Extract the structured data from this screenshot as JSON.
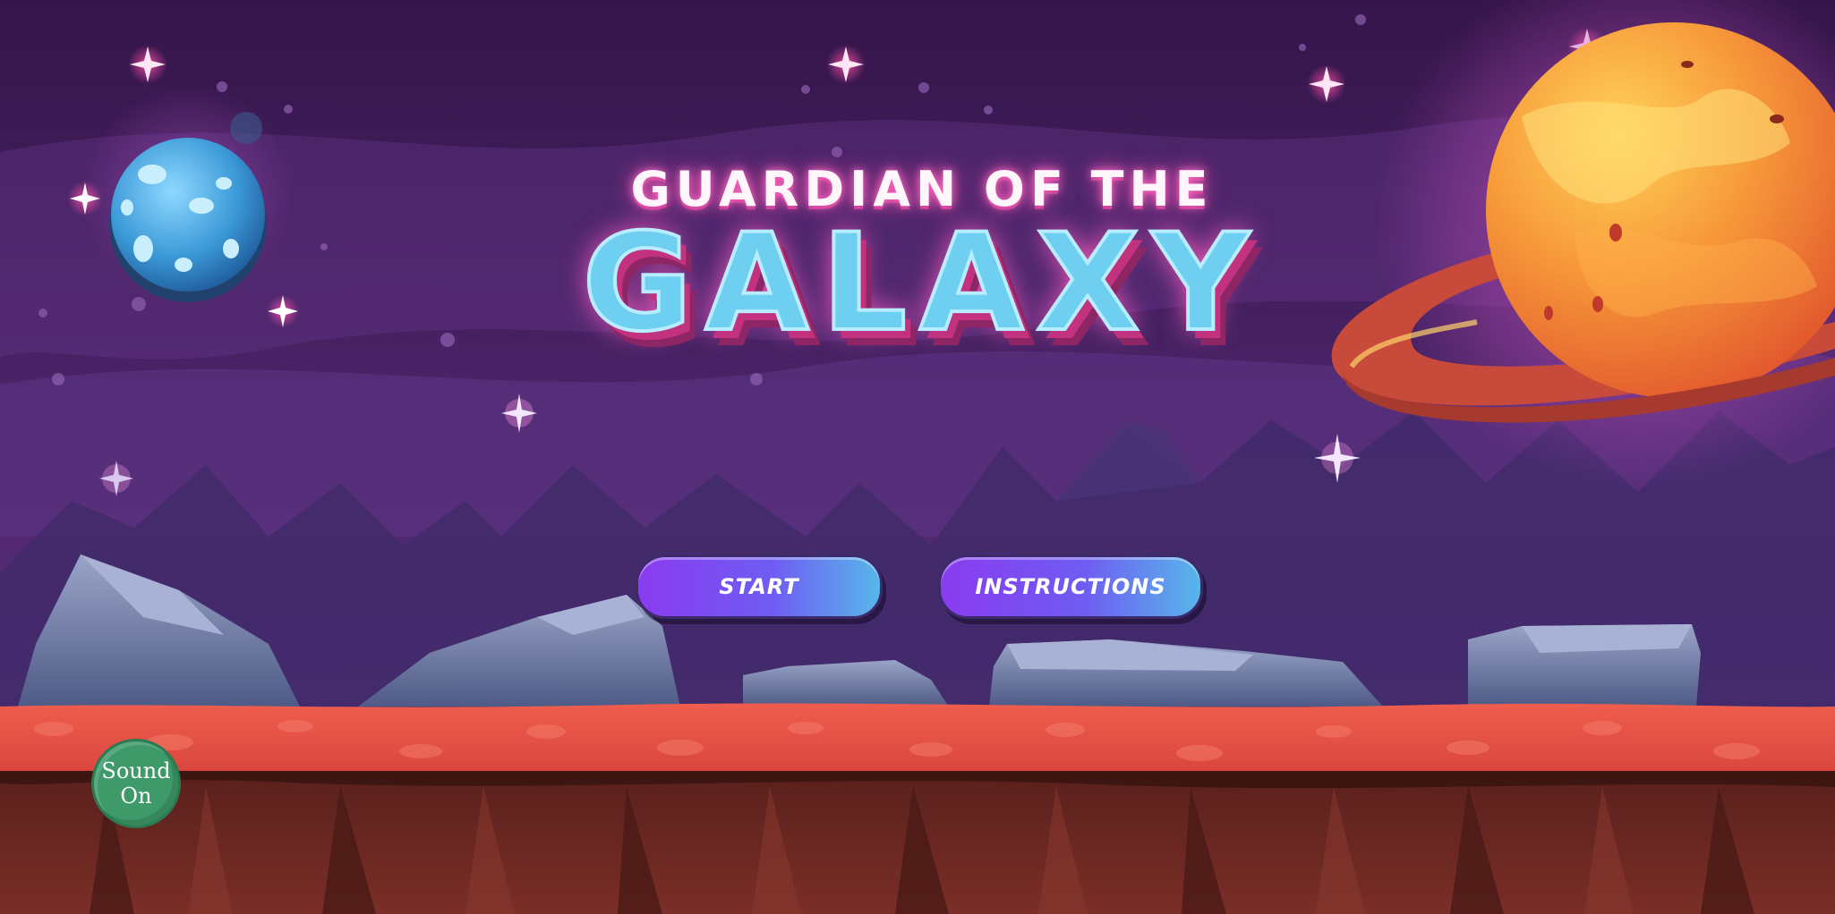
{
  "game": {
    "title_line1": "GUARDIAN OF THE",
    "title_line2": "GALAXY"
  },
  "menu": {
    "start_label": "START",
    "instructions_label": "INSTRUCTIONS"
  },
  "sound_toggle": {
    "line1": "Sound",
    "line2": "On"
  },
  "colors": {
    "sky": "#3a1850",
    "ground_top": "#e8534a",
    "ground_cliff": "#6b2a24",
    "button_gradient_start": "#8a3bf0",
    "button_gradient_end": "#57b6ea",
    "sound_button": "#3f9a6a"
  },
  "icons": [
    "blue-moon-icon",
    "ringed-planet-icon",
    "sparkle-star-icon",
    "rock-icon"
  ]
}
